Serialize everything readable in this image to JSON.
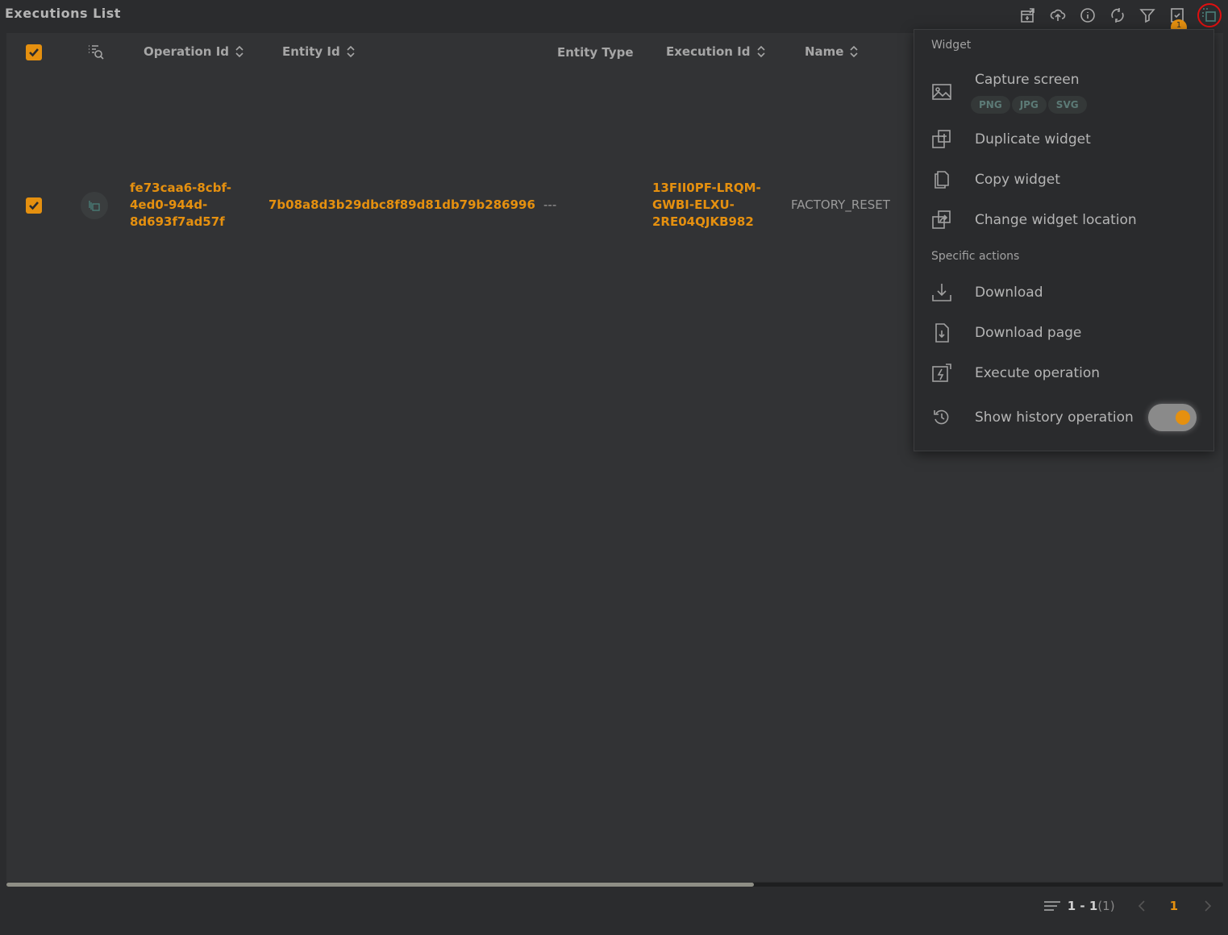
{
  "title": "Executions List",
  "toolbar": {
    "icons": [
      "add-widget-icon",
      "upload-icon",
      "info-icon",
      "refresh-icon",
      "filter-icon",
      "checklist-icon",
      "widget-menu-icon"
    ],
    "badge": "1"
  },
  "table": {
    "columns": [
      "Operation Id",
      "Entity Id",
      "Entity Type",
      "Execution Id",
      "Name"
    ],
    "rows": [
      {
        "checked": true,
        "operation_id": [
          "fe73caa6-8cbf-",
          "4ed0-944d-",
          "8d693f7ad57f"
        ],
        "entity_id": "7b08a8d3b29dbc8f89d81db79b286996",
        "entity_type": "---",
        "execution_id": [
          "13FII0PF-LRQM-",
          "GWBI-ELXU-",
          "2RE04QJKB982"
        ],
        "name": "FACTORY_RESET"
      }
    ]
  },
  "menu": {
    "section_widget": "Widget",
    "capture": "Capture screen",
    "formats": [
      "PNG",
      "JPG",
      "SVG"
    ],
    "duplicate": "Duplicate widget",
    "copy": "Copy widget",
    "change_location": "Change widget location",
    "section_specific": "Specific actions",
    "download": "Download",
    "download_page": "Download page",
    "execute": "Execute operation",
    "history": "Show history operation",
    "history_on": true
  },
  "pager": {
    "range": "1 - 1",
    "total": "(1)",
    "page": "1"
  },
  "colors": {
    "accent": "#e5900f",
    "background": "#323335"
  }
}
